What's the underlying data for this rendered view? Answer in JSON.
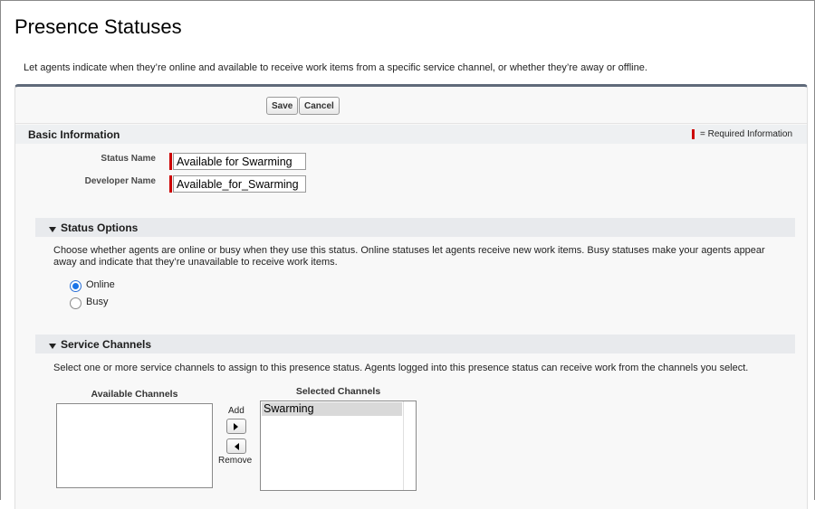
{
  "page": {
    "title": "Presence Statuses",
    "description": "Let agents indicate when they’re online and available to receive work items from a specific service channel, or whether they’re away or offline."
  },
  "toolbar": {
    "save_label": "Save",
    "cancel_label": "Cancel"
  },
  "basic_info": {
    "title": "Basic Information",
    "required_legend": "= Required Information",
    "status_name_label": "Status Name",
    "status_name_value": "Available for Swarming",
    "developer_name_label": "Developer Name",
    "developer_name_value": "Available_for_Swarming"
  },
  "status_options": {
    "title": "Status Options",
    "description": "Choose whether agents are online or busy when they use this status. Online statuses let agents receive new work items. Busy statuses make your agents appear away and indicate that they’re unavailable to receive work items.",
    "options": [
      {
        "label": "Online",
        "selected": true
      },
      {
        "label": "Busy",
        "selected": false
      }
    ]
  },
  "service_channels": {
    "title": "Service Channels",
    "description": "Select one or more service channels to assign to this presence status. Agents logged into this presence status can receive work from the channels you select.",
    "available_label": "Available Channels",
    "selected_label": "Selected Channels",
    "available_items": [],
    "selected_items": [
      "Swarming"
    ],
    "add_label": "Add",
    "remove_label": "Remove"
  },
  "colors": {
    "required": "#cc0000",
    "radio_selected": "#1a73e8",
    "panel_border": "#5f6a7a"
  }
}
